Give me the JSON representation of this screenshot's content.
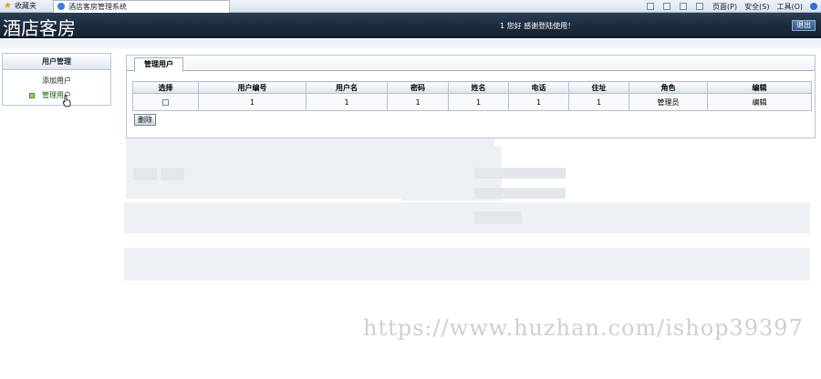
{
  "browser": {
    "favorites_label": "收藏夹",
    "tab_title": "酒店客房管理系统",
    "menu": {
      "page": "页面(P)",
      "safety": "安全(S)",
      "tools": "工具(O)"
    }
  },
  "header": {
    "title": "酒店客房",
    "welcome": "1 您好  感谢登陆使用！",
    "logout_label": "退出"
  },
  "sidebar": {
    "section_title": "用户管理",
    "items": [
      {
        "label": "添加用户"
      },
      {
        "label": "管理用户"
      }
    ]
  },
  "main": {
    "tab_label": "管理用户",
    "table": {
      "columns": [
        "选择",
        "用户编号",
        "用户名",
        "密码",
        "姓名",
        "电话",
        "住址",
        "角色",
        "编辑"
      ],
      "rows": [
        {
          "id": "1",
          "username": "1",
          "password": "1",
          "name": "1",
          "phone": "1",
          "address": "1",
          "role": "管理员",
          "edit": "编辑"
        }
      ]
    },
    "delete_label": "删除"
  },
  "watermark": "https://www.huzhan.com/ishop39397"
}
